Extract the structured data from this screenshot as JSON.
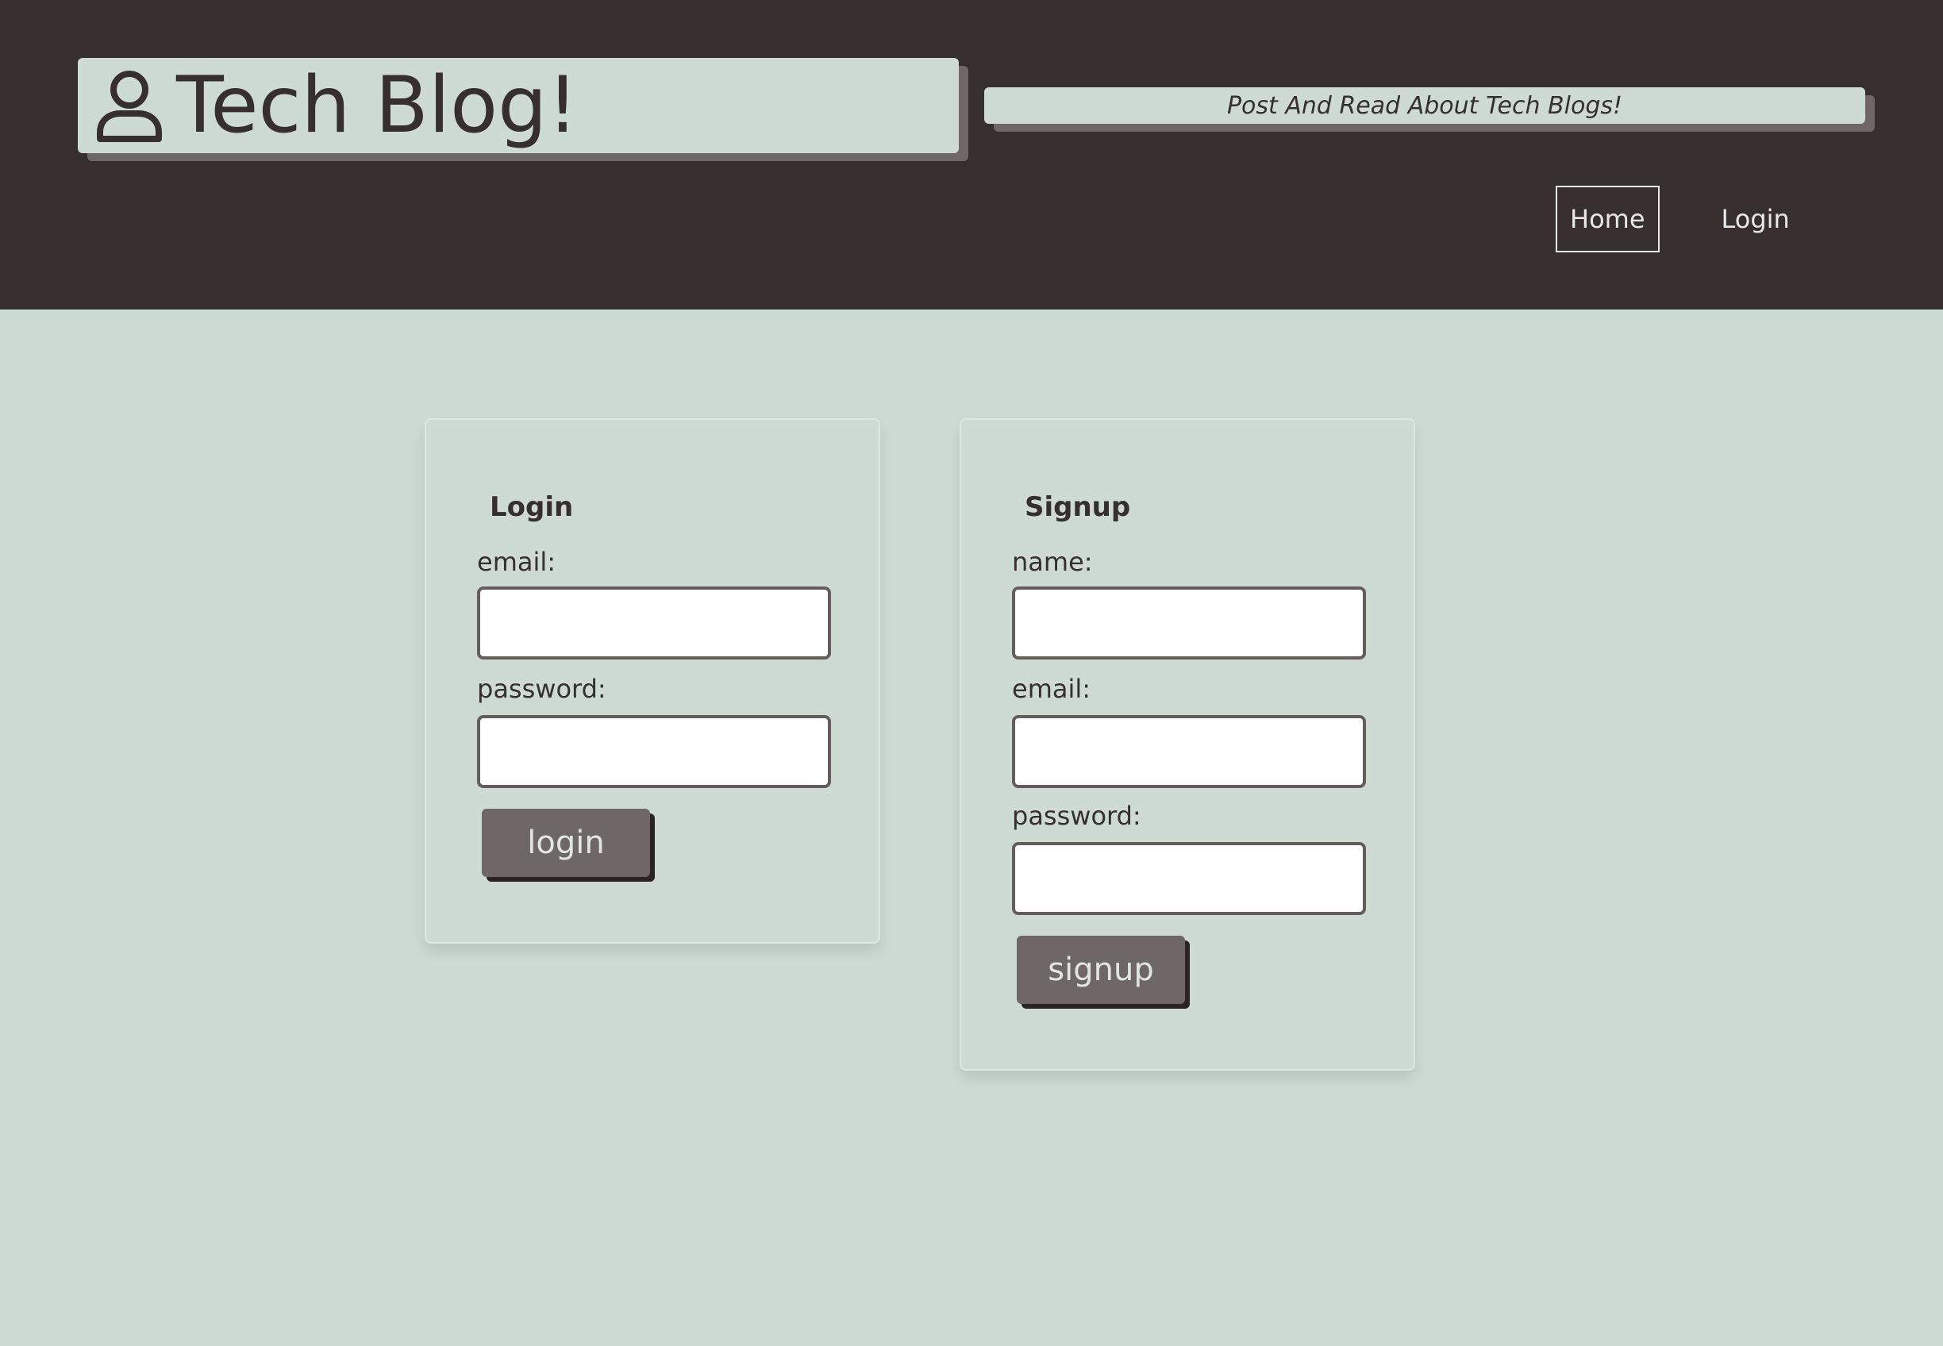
{
  "header": {
    "title": "Tech Blog!",
    "icon": "user-icon",
    "tagline": "Post And Read About Tech Blogs!",
    "nav": [
      {
        "label": "Home",
        "active": true
      },
      {
        "label": "Login",
        "active": false
      }
    ]
  },
  "login_form": {
    "title": "Login",
    "email_label": "email:",
    "email_value": "",
    "password_label": "password:",
    "password_value": "",
    "submit_label": "login"
  },
  "signup_form": {
    "title": "Signup",
    "name_label": "name:",
    "name_value": "",
    "email_label": "email:",
    "email_value": "",
    "password_label": "password:",
    "password_value": "",
    "submit_label": "signup"
  },
  "colors": {
    "header_bg": "#372f2e",
    "page_bg": "#cddbd2",
    "button_bg": "#6f6766",
    "text": "#372f2e"
  }
}
